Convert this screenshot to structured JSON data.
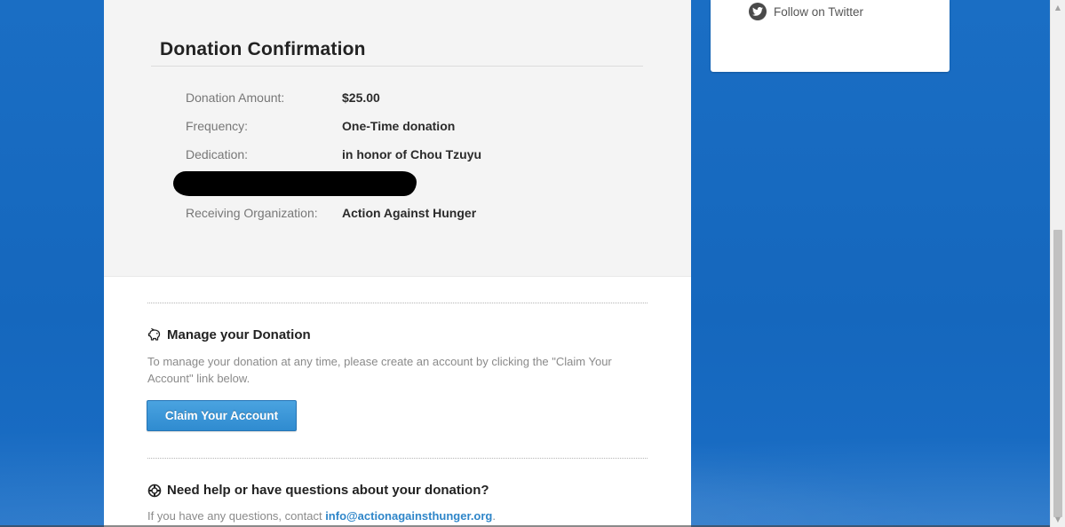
{
  "confirmation": {
    "title": "Donation Confirmation",
    "rows": [
      {
        "label": "Donation Amount:",
        "value": "$25.00"
      },
      {
        "label": "Frequency:",
        "value": "One-Time donation"
      },
      {
        "label": "Dedication:",
        "value": "in honor of Chou Tzuyu"
      },
      {
        "label": "Receiving Organization:",
        "value": "Action Against Hunger"
      }
    ]
  },
  "manage": {
    "icon": "piggy-bank-icon",
    "heading": "Manage your Donation",
    "text": "To manage your donation at any time, please create an account by clicking the \"Claim Your Account\" link below.",
    "button_label": "Claim Your Account"
  },
  "help": {
    "icon": "lifebuoy-icon",
    "heading": "Need help or have questions about your donation?",
    "text_prefix": "If you have any questions, contact ",
    "email": "info@actionagainsthunger.org",
    "text_suffix": "."
  },
  "sidebar": {
    "twitter_icon": "twitter-icon",
    "follow_label": "Follow on Twitter"
  },
  "colors": {
    "background_blue": "#1567bd",
    "button_blue": "#3a93d6",
    "link_blue": "#2f86c9",
    "panel_gray": "#f4f4f4"
  }
}
